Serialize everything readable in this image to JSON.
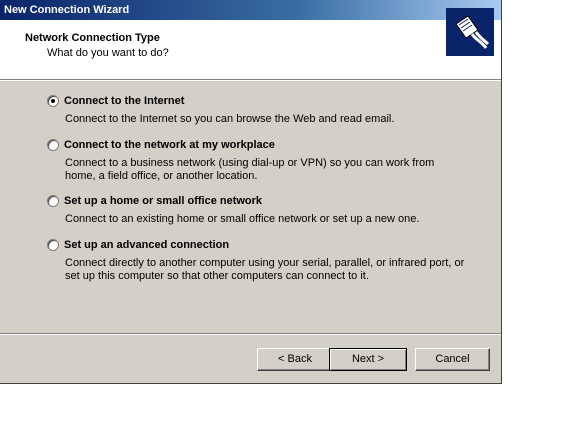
{
  "window": {
    "title": "New Connection Wizard"
  },
  "header": {
    "title": "Network Connection Type",
    "subtitle": "What do you want to do?",
    "logo_icon": "network-cable-icon"
  },
  "options": [
    {
      "label": "Connect to the Internet",
      "desc": "Connect to the Internet so you can browse the Web and read email.",
      "selected": true
    },
    {
      "label": "Connect to the network at my workplace",
      "desc": "Connect to a business network (using dial-up or VPN) so you can work from home, a field office, or another location.",
      "selected": false
    },
    {
      "label": "Set up a home or small office network",
      "desc": "Connect to an existing home or small office network or set up a new one.",
      "selected": false
    },
    {
      "label": "Set up an advanced connection",
      "desc": "Connect directly to another computer using your serial, parallel, or infrared port, or set up this computer so that other computers can connect to it.",
      "selected": false
    }
  ],
  "buttons": {
    "back": "< Back",
    "next": "Next >",
    "cancel": "Cancel"
  },
  "colors": {
    "titlebar_start": "#0a246a",
    "titlebar_end": "#a6caf0",
    "dialog_face": "#d4d0c8"
  }
}
